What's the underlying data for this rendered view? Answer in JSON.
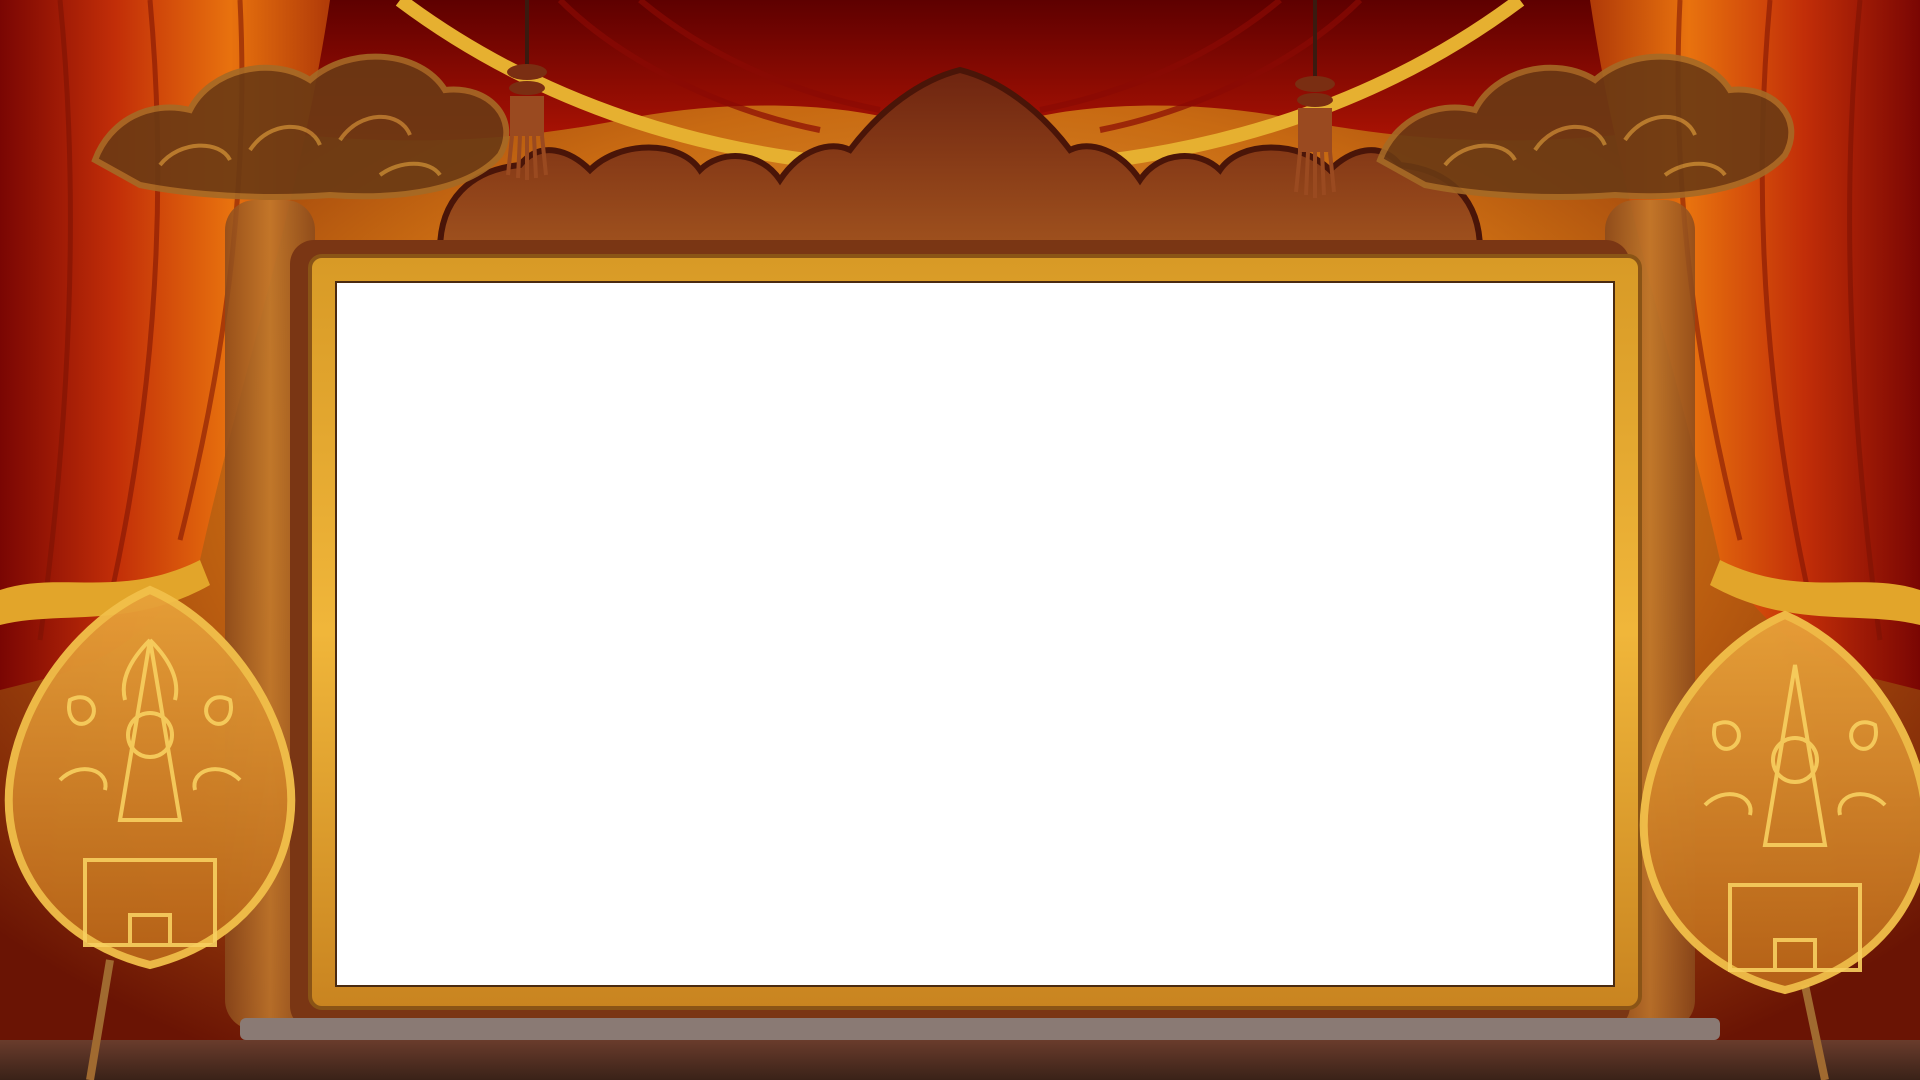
{
  "scene": {
    "name": "wayang-puppet-theater-stage",
    "colors": {
      "curtain_dark": "#6e0000",
      "curtain_mid": "#a40f05",
      "curtain_light": "#d23a0a",
      "curtain_edge_orange": "#e8760c",
      "gold": "#e0a523",
      "gold_light": "#f6c846",
      "wood_dark": "#5a1c0c",
      "wood_mid": "#7a2e12",
      "screen": "#ffffff",
      "floor": "#4a2c22"
    },
    "icons": {
      "cloud_left": "mega-mendung-cloud-icon",
      "cloud_right": "mega-mendung-cloud-icon",
      "tassel_left": "tassel-icon",
      "tassel_right": "tassel-icon",
      "gunungan_left": "gunungan-puppet-icon",
      "gunungan_right": "gunungan-puppet-icon"
    }
  }
}
